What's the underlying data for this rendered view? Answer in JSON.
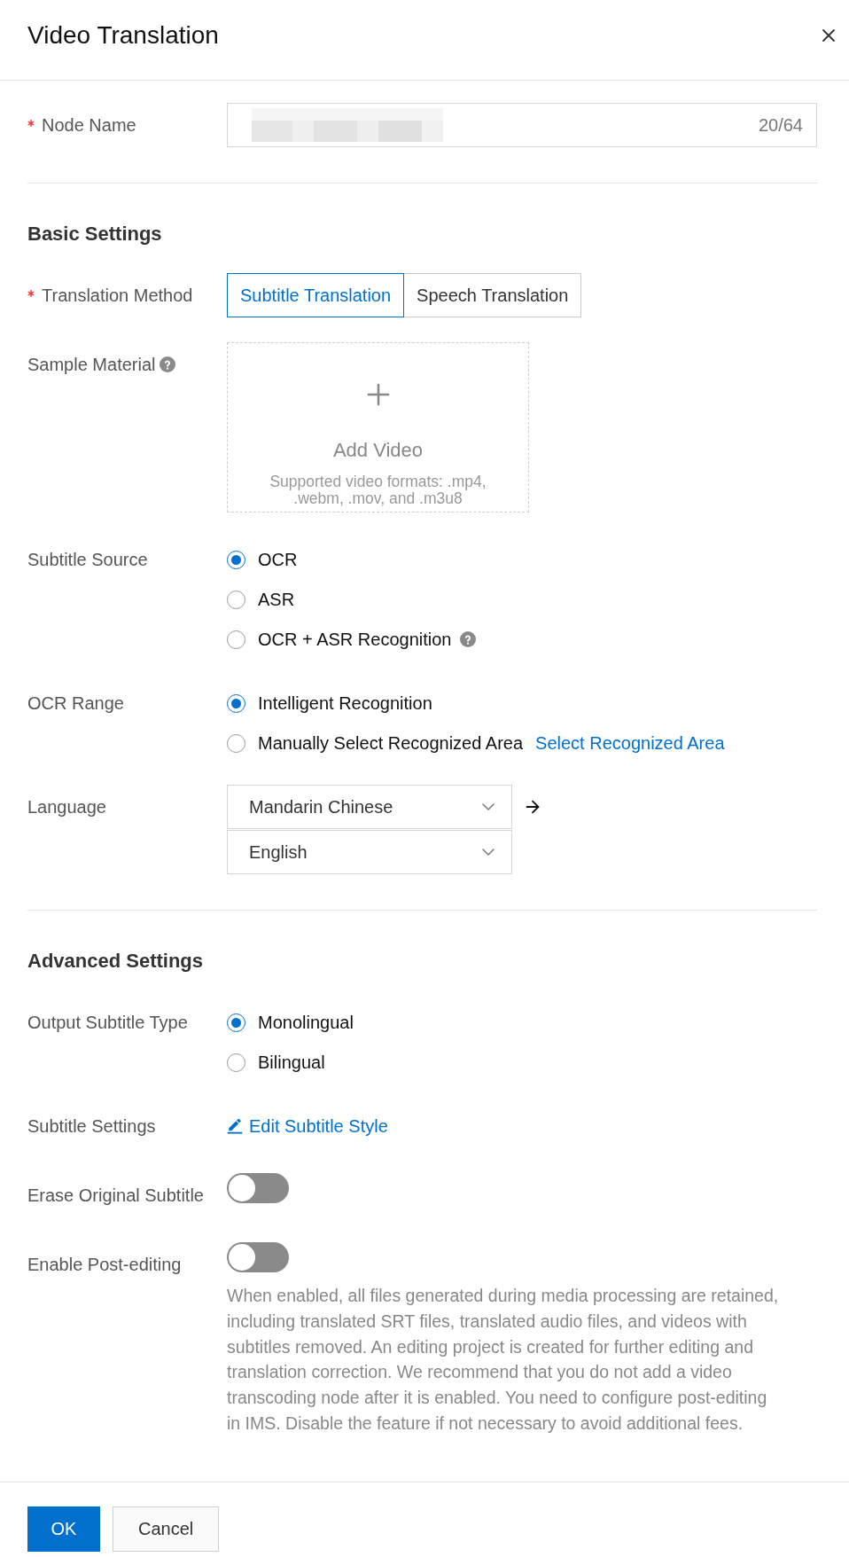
{
  "dialog": {
    "title": "Video Translation"
  },
  "node_name": {
    "kind": "text",
    "label": "Node Name",
    "required": true,
    "value_blurred": true,
    "counter": "20/64"
  },
  "basic_settings": {
    "heading": "Basic Settings",
    "fields": [
      {
        "kind": "segmented",
        "label": "Translation Method",
        "required": true,
        "options": [
          {
            "label": "Subtitle Translation",
            "selected": true
          },
          {
            "label": "Speech Translation",
            "selected": false
          }
        ]
      },
      {
        "kind": "upload",
        "label": "Sample Material",
        "required": false,
        "help": true,
        "upload": {
          "title": "Add Video",
          "hint": "Supported video formats: .mp4, .webm, .mov, and .m3u8"
        }
      },
      {
        "kind": "radio",
        "label": "Subtitle Source",
        "required": false,
        "options": [
          {
            "label": "OCR",
            "selected": true,
            "help": false
          },
          {
            "label": "ASR",
            "selected": false,
            "help": false
          },
          {
            "label": "OCR + ASR Recognition",
            "selected": false,
            "help": true
          }
        ]
      },
      {
        "kind": "radio",
        "label": "OCR Range",
        "required": false,
        "options": [
          {
            "label": "Intelligent Recognition",
            "selected": true
          },
          {
            "label": "Manually Select Recognized Area",
            "selected": false,
            "link": "Select Recognized Area"
          }
        ]
      },
      {
        "kind": "language",
        "label": "Language",
        "required": false,
        "source": "Mandarin Chinese",
        "target": "English"
      }
    ]
  },
  "advanced_settings": {
    "heading": "Advanced Settings",
    "fields": [
      {
        "kind": "radio",
        "label": "Output Subtitle Type",
        "required": false,
        "options": [
          {
            "label": "Monolingual",
            "selected": true
          },
          {
            "label": "Bilingual",
            "selected": false
          }
        ]
      },
      {
        "kind": "link",
        "label": "Subtitle Settings",
        "required": false,
        "link": "Edit Subtitle Style"
      },
      {
        "kind": "toggle",
        "label": "Erase Original Subtitle",
        "required": false,
        "on": false
      },
      {
        "kind": "toggle",
        "label": "Enable Post-editing",
        "required": false,
        "on": false,
        "description": "When enabled, all files generated during media processing are retained, including translated SRT files, translated audio files, and videos with subtitles removed. An editing project is created for further editing and translation correction. We recommend that you do not add a video transcoding node after it is enabled. You need to configure post-editing in IMS. Disable the feature if not necessary to avoid additional fees."
      }
    ]
  },
  "buttons": [
    {
      "label": "OK",
      "kind": "primary"
    },
    {
      "label": "Cancel",
      "kind": "secondary"
    }
  ]
}
